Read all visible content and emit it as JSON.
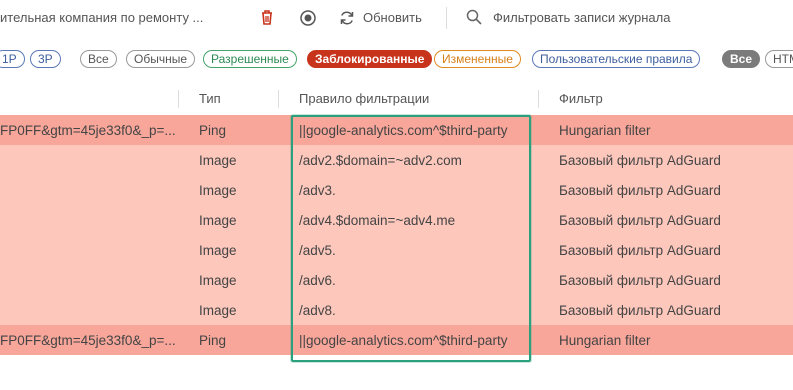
{
  "toolbar": {
    "title": "ительная компания по ремонту ...",
    "refresh_label": "Обновить",
    "filter_placeholder": "Фильтровать записи журнала"
  },
  "chips": {
    "first_party": "1P",
    "third_party": "3P",
    "all": "Все",
    "regular": "Обычные",
    "allowed": "Разрешенные",
    "blocked": "Заблокированные",
    "modified": "Измененные",
    "user_rules": "Пользовательские правила",
    "all_types": "Все",
    "html": "HTML"
  },
  "table": {
    "headers": {
      "type": "Тип",
      "rule": "Правило фильтрации",
      "filter": "Фильтр"
    },
    "rows": [
      {
        "url": "FP0FF&gtm=45je33f0&_p=...",
        "type": "Ping",
        "rule": "||google-analytics.com^$third-party",
        "filter": "Hungarian filter"
      },
      {
        "url": "",
        "type": "Image",
        "rule": "/adv2.$domain=~adv2.com",
        "filter": "Базовый фильтр AdGuard"
      },
      {
        "url": "",
        "type": "Image",
        "rule": "/adv3.",
        "filter": "Базовый фильтр AdGuard"
      },
      {
        "url": "",
        "type": "Image",
        "rule": "/adv4.$domain=~adv4.me",
        "filter": "Базовый фильтр AdGuard"
      },
      {
        "url": "",
        "type": "Image",
        "rule": "/adv5.",
        "filter": "Базовый фильтр AdGuard"
      },
      {
        "url": "",
        "type": "Image",
        "rule": "/adv6.",
        "filter": "Базовый фильтр AdGuard"
      },
      {
        "url": "",
        "type": "Image",
        "rule": "/adv8.",
        "filter": "Базовый фильтр AdGuard"
      },
      {
        "url": "FP0FF&gtm=45je33f0&_p=...",
        "type": "Ping",
        "rule": "||google-analytics.com^$third-party",
        "filter": "Hungarian filter"
      }
    ]
  },
  "colors": {
    "blocked_row_strong": "#f8a69a",
    "blocked_row_light": "#fdc7bc",
    "highlight": "#2aa07c",
    "blocked_chip": "#c8331c"
  },
  "icons": [
    "trash-icon",
    "stop-record-icon",
    "refresh-icon",
    "search-icon"
  ]
}
